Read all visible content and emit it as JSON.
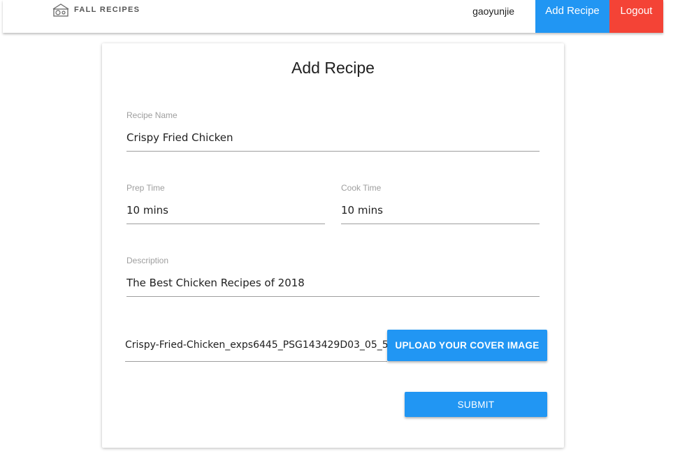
{
  "nav": {
    "brand": "FALL RECIPES",
    "user": "gaoyunjie",
    "add_recipe": "Add Recipe",
    "logout": "Logout",
    "add_color": "#2196F3",
    "logout_color": "#F44336"
  },
  "form": {
    "title": "Add Recipe",
    "recipe_name": {
      "label": "Recipe Name",
      "value": "Crispy Fried Chicken"
    },
    "prep_time": {
      "label": "Prep Time",
      "value": "10 mins"
    },
    "cook_time": {
      "label": "Cook Time",
      "value": "10 mins"
    },
    "description": {
      "label": "Description",
      "value": "The Best Chicken Recipes of 2018"
    },
    "cover_file": "Crispy-Fried-Chicken_exps6445_PSG143429D03_05_5",
    "upload_label": "UPLOAD YOUR COVER IMAGE",
    "submit_label": "SUBMIT"
  },
  "icons": {
    "brand_logo": "camera-house-logo-icon"
  }
}
